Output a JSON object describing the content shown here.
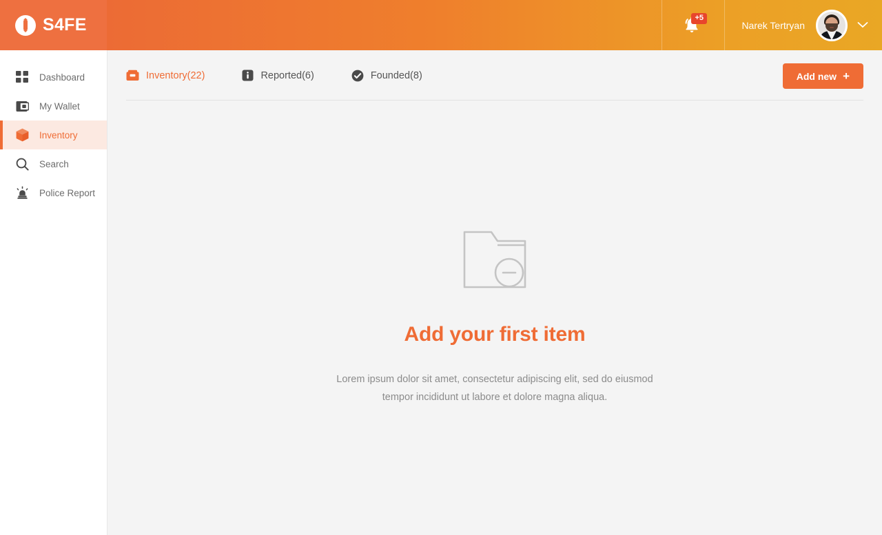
{
  "brand": {
    "name": "S4FE",
    "logo_icon": "s4fe-logo-icon"
  },
  "header": {
    "notification": {
      "icon": "bell-icon",
      "badge": "+5"
    },
    "user": {
      "name": "Narek Tertryan",
      "avatar_icon": "user-avatar",
      "caret_icon": "chevron-down-icon"
    },
    "colors": {
      "gradient_start": "#ec6b35",
      "gradient_end": "#e9a725",
      "brand_panel": "#ee7040"
    }
  },
  "sidebar": {
    "items": [
      {
        "label": "Dashboard",
        "icon": "grid-icon",
        "active": false
      },
      {
        "label": "My Wallet",
        "icon": "wallet-icon",
        "active": false
      },
      {
        "label": "Inventory",
        "icon": "box-icon",
        "active": true
      },
      {
        "label": "Search",
        "icon": "search-icon",
        "active": false
      },
      {
        "label": "Police Report",
        "icon": "siren-icon",
        "active": false
      }
    ]
  },
  "main": {
    "tabs": [
      {
        "label": "Inventory(22)",
        "icon": "toolbox-icon",
        "active": true
      },
      {
        "label": "Reported(6)",
        "icon": "info-icon",
        "active": false
      },
      {
        "label": "Founded(8)",
        "icon": "check-circle-icon",
        "active": false
      }
    ],
    "add_button": {
      "label": "Add new",
      "plus": "+"
    },
    "empty_state": {
      "icon": "empty-folder-icon",
      "title": "Add your first item",
      "description": "Lorem ipsum dolor sit amet, consectetur adipiscing elit, sed do eiusmod tempor incididunt ut labore et dolore magna aliqua."
    },
    "accent_color": "#ef6c35",
    "background": "#f4f4f4"
  }
}
